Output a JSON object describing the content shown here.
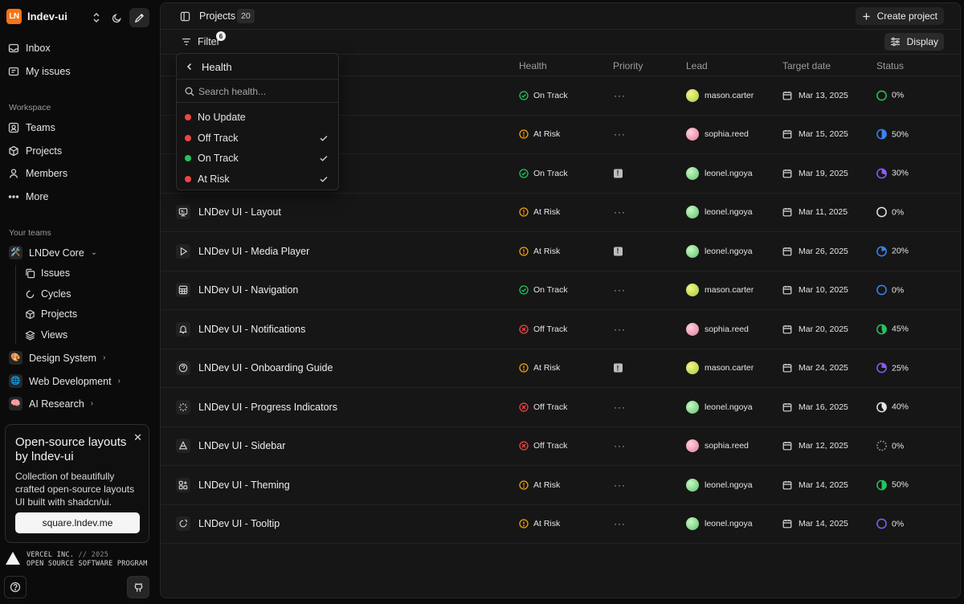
{
  "workspace": {
    "logo_text": "LN",
    "name": "lndev-ui"
  },
  "nav": [
    {
      "label": "Inbox",
      "icon": "inbox-icon"
    },
    {
      "label": "My issues",
      "icon": "issues-icon"
    }
  ],
  "workspace_section": {
    "label": "Workspace",
    "items": [
      {
        "label": "Teams",
        "icon": "teams-icon"
      },
      {
        "label": "Projects",
        "icon": "box-icon"
      },
      {
        "label": "Members",
        "icon": "user-icon"
      },
      {
        "label": "More",
        "icon": "more-icon"
      }
    ]
  },
  "teams_section": {
    "label": "Your teams",
    "teams": [
      {
        "name": "LNDev Core",
        "emoji": "🛠️",
        "expanded": true
      },
      {
        "name": "Design System",
        "emoji": "🎨",
        "expanded": false
      },
      {
        "name": "Web Development",
        "emoji": "🌐",
        "expanded": false
      },
      {
        "name": "AI Research",
        "emoji": "🧠",
        "expanded": false
      }
    ],
    "sub_items": [
      {
        "label": "Issues"
      },
      {
        "label": "Cycles"
      },
      {
        "label": "Projects"
      },
      {
        "label": "Views"
      }
    ]
  },
  "promo": {
    "title": "Open-source layouts by lndev-ui",
    "description": "Collection of beautifully crafted open-source layouts UI built with shadcn/ui.",
    "button": "square.lndev.me"
  },
  "footer": {
    "line1": "VERCEL INC.",
    "line1_dim": "// 2025",
    "line2": "OPEN SOURCE SOFTWARE PROGRAM"
  },
  "topbar": {
    "title": "Projects",
    "count": "20",
    "create_label": "Create project"
  },
  "filterbar": {
    "filter_label": "Filter",
    "filter_count": "6",
    "display_label": "Display"
  },
  "columns": {
    "health": "Health",
    "priority": "Priority",
    "lead": "Lead",
    "target_date": "Target date",
    "status": "Status"
  },
  "colors": {
    "on_track": "#22c55e",
    "at_risk": "#f59e0b",
    "off_track": "#ef4444",
    "no_update": "#ef4444",
    "brand": "#f97316"
  },
  "dropdown": {
    "title": "Health",
    "search_placeholder": "Search health...",
    "options": [
      {
        "label": "No Update",
        "color": "#ef4444",
        "checked": false
      },
      {
        "label": "Off Track",
        "color": "#ef4444",
        "checked": true
      },
      {
        "label": "On Track",
        "color": "#22c55e",
        "checked": true
      },
      {
        "label": "At Risk",
        "color": "#ef4444",
        "checked": true
      }
    ]
  },
  "projects": [
    {
      "name": "",
      "icon": "none",
      "health": "On Track",
      "priority": "none",
      "lead": "mason.carter",
      "lead_color": "yellow",
      "date": "Mar 13, 2025",
      "status": "0%",
      "status_color": "#22c55e"
    },
    {
      "name": "",
      "icon": "none",
      "health": "At Risk",
      "priority": "none",
      "lead": "sophia.reed",
      "lead_color": "pink",
      "date": "Mar 15, 2025",
      "status": "50%",
      "status_color": "#3b82f6"
    },
    {
      "name": "",
      "icon": "none",
      "health": "On Track",
      "priority": "urgent",
      "lead": "leonel.ngoya",
      "lead_color": "green",
      "date": "Mar 19, 2025",
      "status": "30%",
      "status_color": "#8b5cf6"
    },
    {
      "name": "LNDev UI - Layout",
      "icon": "layout-icon",
      "health": "At Risk",
      "priority": "none",
      "lead": "leonel.ngoya",
      "lead_color": "green",
      "date": "Mar 11, 2025",
      "status": "0%",
      "status_color": "#e5e5e5"
    },
    {
      "name": "LNDev UI - Media Player",
      "icon": "play-icon",
      "health": "At Risk",
      "priority": "urgent",
      "lead": "leonel.ngoya",
      "lead_color": "green",
      "date": "Mar 26, 2025",
      "status": "20%",
      "status_color": "#3b82f6"
    },
    {
      "name": "LNDev UI - Navigation",
      "icon": "grid-icon",
      "health": "On Track",
      "priority": "none",
      "lead": "mason.carter",
      "lead_color": "yellow",
      "date": "Mar 10, 2025",
      "status": "0%",
      "status_color": "#3b82f6"
    },
    {
      "name": "LNDev UI - Notifications",
      "icon": "bell-icon",
      "health": "Off Track",
      "priority": "none",
      "lead": "sophia.reed",
      "lead_color": "pink",
      "date": "Mar 20, 2025",
      "status": "45%",
      "status_color": "#22c55e"
    },
    {
      "name": "LNDev UI - Onboarding Guide",
      "icon": "help-icon",
      "health": "At Risk",
      "priority": "urgent",
      "lead": "mason.carter",
      "lead_color": "yellow",
      "date": "Mar 24, 2025",
      "status": "25%",
      "status_color": "#8b5cf6"
    },
    {
      "name": "LNDev UI - Progress Indicators",
      "icon": "loader-icon",
      "health": "Off Track",
      "priority": "none",
      "lead": "leonel.ngoya",
      "lead_color": "green",
      "date": "Mar 16, 2025",
      "status": "40%",
      "status_color": "#e5e5e5"
    },
    {
      "name": "LNDev UI - Sidebar",
      "icon": "sidebar-icon",
      "health": "Off Track",
      "priority": "none",
      "lead": "sophia.reed",
      "lead_color": "pink",
      "date": "Mar 12, 2025",
      "status": "0%",
      "status_color": "#9a9a9a"
    },
    {
      "name": "LNDev UI - Theming",
      "icon": "theme-icon",
      "health": "At Risk",
      "priority": "none",
      "lead": "leonel.ngoya",
      "lead_color": "green",
      "date": "Mar 14, 2025",
      "status": "50%",
      "status_color": "#22c55e"
    },
    {
      "name": "LNDev UI - Tooltip",
      "icon": "tooltip-icon",
      "health": "At Risk",
      "priority": "none",
      "lead": "leonel.ngoya",
      "lead_color": "green",
      "date": "Mar 14, 2025",
      "status": "0%",
      "status_color": "#8b5cf6"
    }
  ]
}
